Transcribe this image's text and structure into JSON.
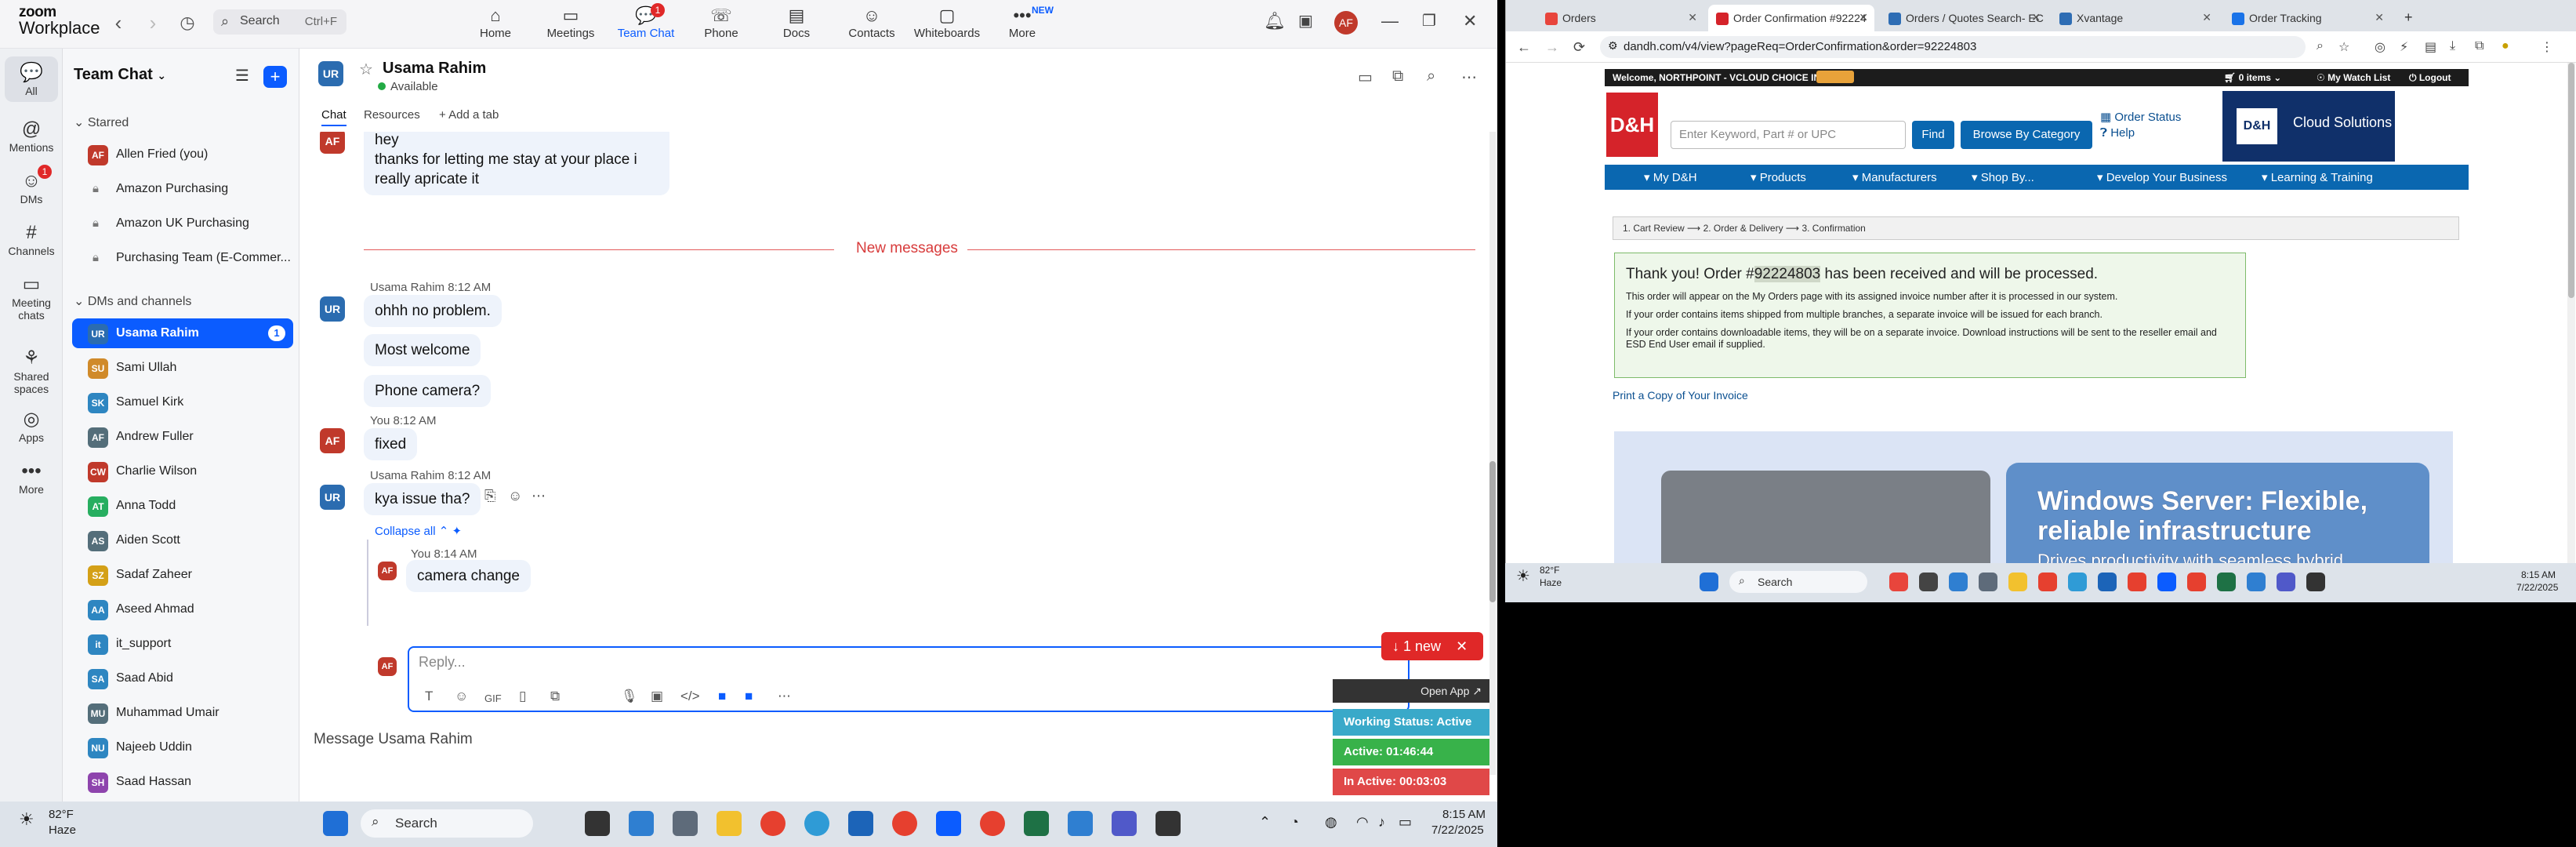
{
  "zoom": {
    "logo_line1": "zoom",
    "logo_line2": "Workplace",
    "search_label": "Search",
    "search_shortcut": "Ctrl+F",
    "tabs": [
      {
        "label": "Home",
        "icon": "⌂"
      },
      {
        "label": "Meetings",
        "icon": "▭"
      },
      {
        "label": "Team Chat",
        "icon": "💬",
        "badge": "1"
      },
      {
        "label": "Phone",
        "icon": "☏"
      },
      {
        "label": "Docs",
        "icon": "▤"
      },
      {
        "label": "Contacts",
        "icon": "☺"
      },
      {
        "label": "Whiteboards",
        "icon": "▢"
      },
      {
        "label": "More",
        "icon": "•••",
        "tag": "NEW"
      }
    ],
    "avatar_initials": "AF",
    "rail": [
      {
        "label": "All",
        "icon": "💬"
      },
      {
        "label": "Mentions",
        "icon": "@"
      },
      {
        "label": "DMs",
        "icon": "☺",
        "badge": "1"
      },
      {
        "label": "Channels",
        "icon": "#"
      },
      {
        "label": "Meeting chats",
        "icon": "▭"
      },
      {
        "label": "Shared spaces",
        "icon": "⚘"
      },
      {
        "label": "Apps",
        "icon": "◎"
      },
      {
        "label": "More",
        "icon": "•••"
      }
    ],
    "sidebar": {
      "title": "Team Chat",
      "starred_label": "Starred",
      "dm_label": "DMs and channels",
      "starred": [
        {
          "name": "Allen Fried (you)",
          "initials": "AF",
          "color": "#c0392b"
        },
        {
          "name": "Amazon Purchasing",
          "lock": true
        },
        {
          "name": "Amazon UK Purchasing",
          "lock": true
        },
        {
          "name": "Purchasing Team (E-Commer...",
          "lock": true
        }
      ],
      "dms": [
        {
          "name": "Usama Rahim",
          "initials": "UR",
          "color": "#2b6cb0",
          "count": "1",
          "selected": true
        },
        {
          "name": "Sami Ullah",
          "initials": "SU",
          "color": "#d08a2a"
        },
        {
          "name": "Samuel Kirk",
          "initials": "SK",
          "color": "#2e86c1"
        },
        {
          "name": "Andrew Fuller",
          "initials": "AF",
          "color": "#546e7a"
        },
        {
          "name": "Charlie Wilson",
          "initials": "CW",
          "color": "#c0392b"
        },
        {
          "name": "Anna Todd",
          "initials": "AT",
          "color": "#27ae60"
        },
        {
          "name": "Aiden Scott",
          "initials": "AS",
          "color": "#546e7a"
        },
        {
          "name": "Sadaf Zaheer",
          "initials": "SZ",
          "color": "#d4a017"
        },
        {
          "name": "Aseed Ahmad",
          "initials": "AA",
          "color": "#2e86c1"
        },
        {
          "name": "it_support",
          "initials": "it",
          "color": "#2e86c1"
        },
        {
          "name": "Saad Abid",
          "initials": "SA",
          "color": "#2e86c1"
        },
        {
          "name": "Muhammad Umair",
          "initials": "MU",
          "color": "#546e7a"
        },
        {
          "name": "Najeeb Uddin",
          "initials": "NU",
          "color": "#2e86c1"
        },
        {
          "name": "Saad Hassan",
          "initials": "SH",
          "color": "#8e44ad"
        }
      ]
    },
    "chat": {
      "name": "Usama Rahim",
      "initials": "UR",
      "status": "Available",
      "tabs": [
        "Chat",
        "Resources",
        "+ Add a tab"
      ],
      "new_messages": "New messages",
      "messages": [
        {
          "line1": "hey",
          "line2": "thanks for letting me stay at your place i really apricate it"
        },
        {
          "meta": "Usama Rahim  8:12 AM",
          "texts": [
            "ohhh no problem.",
            "Most welcome",
            "Phone camera?"
          ]
        },
        {
          "meta": "You  8:12 AM",
          "texts": [
            "fixed"
          ]
        },
        {
          "meta": "Usama Rahim  8:12 AM",
          "texts": [
            "kya issue tha?"
          ]
        },
        {
          "collapse": "Collapse all"
        },
        {
          "meta": "You  8:14 AM",
          "texts": [
            "camera change"
          ]
        }
      ],
      "reply_placeholder": "Reply...",
      "new_pill": "1 new",
      "compose_placeholder": "Message Usama Rahim"
    },
    "timewidget": {
      "open_app": "Open App ↗",
      "working": "Working Status: Active",
      "active": "Active: 01:46:44",
      "inactive": "In Active: 00:03:03",
      "colors": {
        "working": "#39a9c9",
        "active": "#38b24a",
        "inactive": "#e04848"
      }
    }
  },
  "taskbar1": {
    "weather_temp": "82°F",
    "weather_desc": "Haze",
    "search": "Search",
    "time": "8:15 AM",
    "date": "7/22/2025"
  },
  "browser": {
    "tabs": [
      {
        "title": "Orders",
        "fav": "#e8453c"
      },
      {
        "title": "Order Confirmation #92224",
        "fav": "#d5232a",
        "active": true
      },
      {
        "title": "Orders / Quotes Search- EC",
        "fav": "#2e6db4"
      },
      {
        "title": "Xvantage",
        "fav": "#2e6db4"
      },
      {
        "title": "Order Tracking",
        "fav": "#1a73e8"
      }
    ],
    "url": "dandh.com/v4/view?pageReq=OrderConfirmation&order=92224803",
    "site": {
      "welcome": "Welcome, NORTHPOINT - VCLOUD CHOICE INC",
      "items": "0 items",
      "watch": "My Watch List",
      "logout": "Logout",
      "logo": "D&H",
      "search_placeholder": "Enter Keyword, Part # or UPC",
      "find": "Find",
      "browse": "Browse By Category",
      "order_status": "Order Status",
      "help": "Help",
      "cloud": "Cloud Solutions",
      "cloud_logo": "D&H",
      "menu": [
        "▾ My D&H",
        "▾ Products",
        "▾ Manufacturers",
        "▾ Shop By...",
        "▾ Develop Your Business",
        "▾ Learning & Training"
      ],
      "crumb": "1. Cart Review  ⟶   2. Order & Delivery  ⟶   3. Confirmation",
      "confirm_pre": "Thank you! Order #",
      "order_no": "92224803",
      "confirm_post": " has been received and will be processed.",
      "p1": "This order will appear on the My Orders page with its assigned invoice number after it is processed in our system.",
      "p2": "If your order contains items shipped from multiple branches, a separate invoice will be issued for each branch.",
      "p3": "If your order contains downloadable items, they will be on a separate invoice. Download instructions will be sent to the reseller email and ESD End User email if supplied.",
      "print": "Print a Copy of Your Invoice",
      "banner_line1": "Windows Server: Flexible,",
      "banner_line2": "reliable infrastructure",
      "banner_line3": "Drives productivity with seamless hybrid"
    }
  },
  "taskbar2": {
    "weather_temp": "82°F",
    "weather_desc": "Haze",
    "search": "Search",
    "time": "8:15 AM",
    "date": "7/22/2025"
  }
}
